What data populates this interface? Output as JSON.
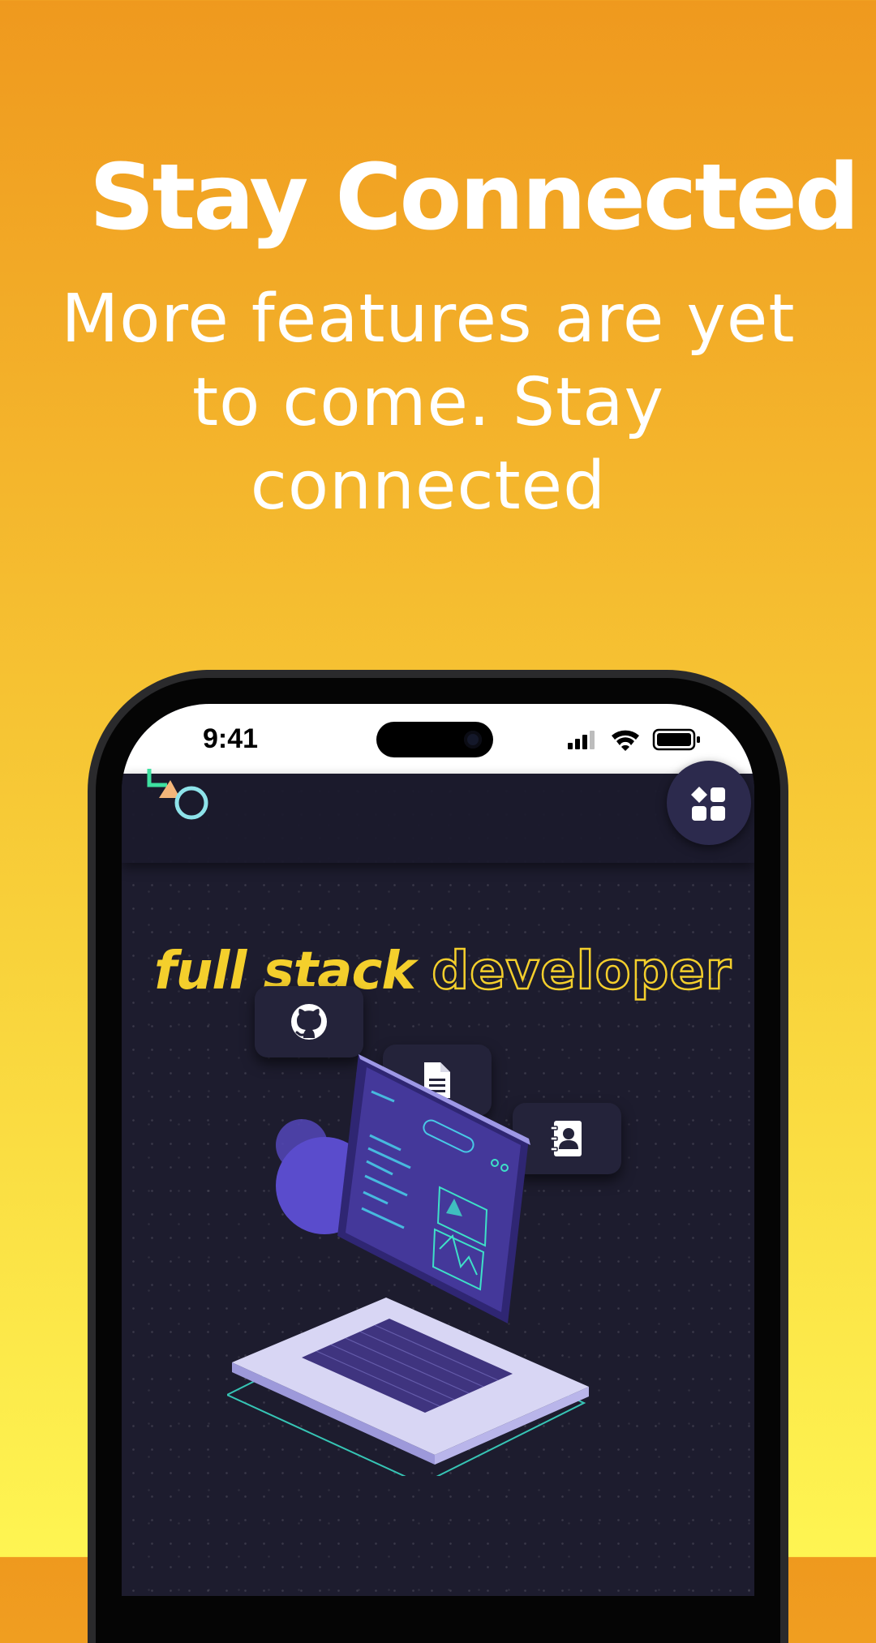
{
  "headline": "Stay Connected",
  "subtitle": "More features are yet to come. Stay connected",
  "phone": {
    "status_time": "9:41",
    "status_icons": [
      "signal-icon",
      "wifi-icon",
      "battery-icon"
    ]
  },
  "app": {
    "logo": "shapes-logo-icon",
    "menu_icon": "grid-menu-icon",
    "title_part1": "full stack",
    "title_part2": "developer",
    "icon_cards": [
      "github-icon",
      "document-icon",
      "contact-book-icon"
    ],
    "illustration": "laptop-illustration"
  },
  "colors": {
    "gradient_top": "#ef991e",
    "gradient_bottom": "#fef552",
    "app_background": "#1d1c2e",
    "title_yellow": "#f4cf2c",
    "accent_purple": "#5a4ccc",
    "accent_teal": "#3ee0c8"
  }
}
